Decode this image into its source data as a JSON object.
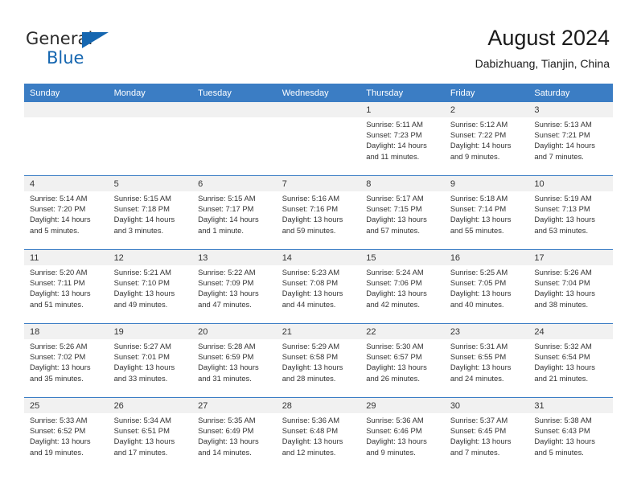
{
  "brand": {
    "name_part1": "General",
    "name_part2": "Blue",
    "triangle_icon": "triangle-icon"
  },
  "header": {
    "title": "August 2024",
    "subtitle": "Dabizhuang, Tianjin, China"
  },
  "colors": {
    "header_blue": "#3b7dc4",
    "brand_blue": "#1566b0",
    "daynum_band": "#f1f1f1",
    "text": "#333333"
  },
  "weekday_headers": [
    "Sunday",
    "Monday",
    "Tuesday",
    "Wednesday",
    "Thursday",
    "Friday",
    "Saturday"
  ],
  "weeks": [
    {
      "daynums": [
        "",
        "",
        "",
        "",
        "1",
        "2",
        "3"
      ],
      "cells": [
        {
          "sunrise": "",
          "sunset": "",
          "daylight1": "",
          "daylight2": ""
        },
        {
          "sunrise": "",
          "sunset": "",
          "daylight1": "",
          "daylight2": ""
        },
        {
          "sunrise": "",
          "sunset": "",
          "daylight1": "",
          "daylight2": ""
        },
        {
          "sunrise": "",
          "sunset": "",
          "daylight1": "",
          "daylight2": ""
        },
        {
          "sunrise": "Sunrise: 5:11 AM",
          "sunset": "Sunset: 7:23 PM",
          "daylight1": "Daylight: 14 hours",
          "daylight2": "and 11 minutes."
        },
        {
          "sunrise": "Sunrise: 5:12 AM",
          "sunset": "Sunset: 7:22 PM",
          "daylight1": "Daylight: 14 hours",
          "daylight2": "and 9 minutes."
        },
        {
          "sunrise": "Sunrise: 5:13 AM",
          "sunset": "Sunset: 7:21 PM",
          "daylight1": "Daylight: 14 hours",
          "daylight2": "and 7 minutes."
        }
      ]
    },
    {
      "daynums": [
        "4",
        "5",
        "6",
        "7",
        "8",
        "9",
        "10"
      ],
      "cells": [
        {
          "sunrise": "Sunrise: 5:14 AM",
          "sunset": "Sunset: 7:20 PM",
          "daylight1": "Daylight: 14 hours",
          "daylight2": "and 5 minutes."
        },
        {
          "sunrise": "Sunrise: 5:15 AM",
          "sunset": "Sunset: 7:18 PM",
          "daylight1": "Daylight: 14 hours",
          "daylight2": "and 3 minutes."
        },
        {
          "sunrise": "Sunrise: 5:15 AM",
          "sunset": "Sunset: 7:17 PM",
          "daylight1": "Daylight: 14 hours",
          "daylight2": "and 1 minute."
        },
        {
          "sunrise": "Sunrise: 5:16 AM",
          "sunset": "Sunset: 7:16 PM",
          "daylight1": "Daylight: 13 hours",
          "daylight2": "and 59 minutes."
        },
        {
          "sunrise": "Sunrise: 5:17 AM",
          "sunset": "Sunset: 7:15 PM",
          "daylight1": "Daylight: 13 hours",
          "daylight2": "and 57 minutes."
        },
        {
          "sunrise": "Sunrise: 5:18 AM",
          "sunset": "Sunset: 7:14 PM",
          "daylight1": "Daylight: 13 hours",
          "daylight2": "and 55 minutes."
        },
        {
          "sunrise": "Sunrise: 5:19 AM",
          "sunset": "Sunset: 7:13 PM",
          "daylight1": "Daylight: 13 hours",
          "daylight2": "and 53 minutes."
        }
      ]
    },
    {
      "daynums": [
        "11",
        "12",
        "13",
        "14",
        "15",
        "16",
        "17"
      ],
      "cells": [
        {
          "sunrise": "Sunrise: 5:20 AM",
          "sunset": "Sunset: 7:11 PM",
          "daylight1": "Daylight: 13 hours",
          "daylight2": "and 51 minutes."
        },
        {
          "sunrise": "Sunrise: 5:21 AM",
          "sunset": "Sunset: 7:10 PM",
          "daylight1": "Daylight: 13 hours",
          "daylight2": "and 49 minutes."
        },
        {
          "sunrise": "Sunrise: 5:22 AM",
          "sunset": "Sunset: 7:09 PM",
          "daylight1": "Daylight: 13 hours",
          "daylight2": "and 47 minutes."
        },
        {
          "sunrise": "Sunrise: 5:23 AM",
          "sunset": "Sunset: 7:08 PM",
          "daylight1": "Daylight: 13 hours",
          "daylight2": "and 44 minutes."
        },
        {
          "sunrise": "Sunrise: 5:24 AM",
          "sunset": "Sunset: 7:06 PM",
          "daylight1": "Daylight: 13 hours",
          "daylight2": "and 42 minutes."
        },
        {
          "sunrise": "Sunrise: 5:25 AM",
          "sunset": "Sunset: 7:05 PM",
          "daylight1": "Daylight: 13 hours",
          "daylight2": "and 40 minutes."
        },
        {
          "sunrise": "Sunrise: 5:26 AM",
          "sunset": "Sunset: 7:04 PM",
          "daylight1": "Daylight: 13 hours",
          "daylight2": "and 38 minutes."
        }
      ]
    },
    {
      "daynums": [
        "18",
        "19",
        "20",
        "21",
        "22",
        "23",
        "24"
      ],
      "cells": [
        {
          "sunrise": "Sunrise: 5:26 AM",
          "sunset": "Sunset: 7:02 PM",
          "daylight1": "Daylight: 13 hours",
          "daylight2": "and 35 minutes."
        },
        {
          "sunrise": "Sunrise: 5:27 AM",
          "sunset": "Sunset: 7:01 PM",
          "daylight1": "Daylight: 13 hours",
          "daylight2": "and 33 minutes."
        },
        {
          "sunrise": "Sunrise: 5:28 AM",
          "sunset": "Sunset: 6:59 PM",
          "daylight1": "Daylight: 13 hours",
          "daylight2": "and 31 minutes."
        },
        {
          "sunrise": "Sunrise: 5:29 AM",
          "sunset": "Sunset: 6:58 PM",
          "daylight1": "Daylight: 13 hours",
          "daylight2": "and 28 minutes."
        },
        {
          "sunrise": "Sunrise: 5:30 AM",
          "sunset": "Sunset: 6:57 PM",
          "daylight1": "Daylight: 13 hours",
          "daylight2": "and 26 minutes."
        },
        {
          "sunrise": "Sunrise: 5:31 AM",
          "sunset": "Sunset: 6:55 PM",
          "daylight1": "Daylight: 13 hours",
          "daylight2": "and 24 minutes."
        },
        {
          "sunrise": "Sunrise: 5:32 AM",
          "sunset": "Sunset: 6:54 PM",
          "daylight1": "Daylight: 13 hours",
          "daylight2": "and 21 minutes."
        }
      ]
    },
    {
      "daynums": [
        "25",
        "26",
        "27",
        "28",
        "29",
        "30",
        "31"
      ],
      "cells": [
        {
          "sunrise": "Sunrise: 5:33 AM",
          "sunset": "Sunset: 6:52 PM",
          "daylight1": "Daylight: 13 hours",
          "daylight2": "and 19 minutes."
        },
        {
          "sunrise": "Sunrise: 5:34 AM",
          "sunset": "Sunset: 6:51 PM",
          "daylight1": "Daylight: 13 hours",
          "daylight2": "and 17 minutes."
        },
        {
          "sunrise": "Sunrise: 5:35 AM",
          "sunset": "Sunset: 6:49 PM",
          "daylight1": "Daylight: 13 hours",
          "daylight2": "and 14 minutes."
        },
        {
          "sunrise": "Sunrise: 5:36 AM",
          "sunset": "Sunset: 6:48 PM",
          "daylight1": "Daylight: 13 hours",
          "daylight2": "and 12 minutes."
        },
        {
          "sunrise": "Sunrise: 5:36 AM",
          "sunset": "Sunset: 6:46 PM",
          "daylight1": "Daylight: 13 hours",
          "daylight2": "and 9 minutes."
        },
        {
          "sunrise": "Sunrise: 5:37 AM",
          "sunset": "Sunset: 6:45 PM",
          "daylight1": "Daylight: 13 hours",
          "daylight2": "and 7 minutes."
        },
        {
          "sunrise": "Sunrise: 5:38 AM",
          "sunset": "Sunset: 6:43 PM",
          "daylight1": "Daylight: 13 hours",
          "daylight2": "and 5 minutes."
        }
      ]
    }
  ]
}
